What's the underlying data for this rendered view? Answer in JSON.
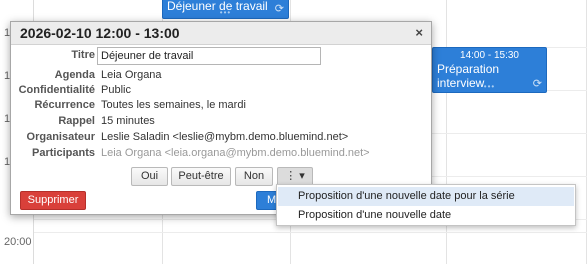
{
  "calendar": {
    "time_labels": [
      "1",
      "1",
      "1",
      "1",
      "20:00"
    ],
    "events": [
      {
        "title": "Déjeuner de travail",
        "time": ""
      },
      {
        "title": "Préparation interview",
        "time": "14:00 - 15:30"
      }
    ]
  },
  "popup": {
    "header_title": "2026-02-10 12:00 - 13:00",
    "close_icon": "×",
    "fields": {
      "titre_label": "Titre",
      "titre_value": "Déjeuner de travail",
      "agenda_label": "Agenda",
      "agenda_value": "Leia Organa",
      "confidentialite_label": "Confidentialité",
      "confidentialite_value": "Public",
      "recurrence_label": "Récurrence",
      "recurrence_value": "Toutes les semaines, le mardi",
      "rappel_label": "Rappel",
      "rappel_value": "15 minutes",
      "organisateur_label": "Organisateur",
      "organisateur_value": "Leslie Saladin <leslie@mybm.demo.bluemind.net>",
      "participants_label": "Participants",
      "participants_value": "Leia Organa <leia.organa@mybm.demo.bluemind.net>"
    },
    "buttons": {
      "oui": "Oui",
      "peut_etre": "Peut-être",
      "non": "Non",
      "more": "⋮ ▾",
      "supprimer": "Supprimer",
      "modifier_partial": "Mo"
    }
  },
  "dropdown": {
    "items": [
      "Proposition d'une nouvelle date pour la série",
      "Proposition d'une nouvelle date"
    ]
  },
  "colors": {
    "event_blue": "#2d7fd8",
    "delete_red": "#d9403a",
    "highlight": "#dfeaf7"
  }
}
